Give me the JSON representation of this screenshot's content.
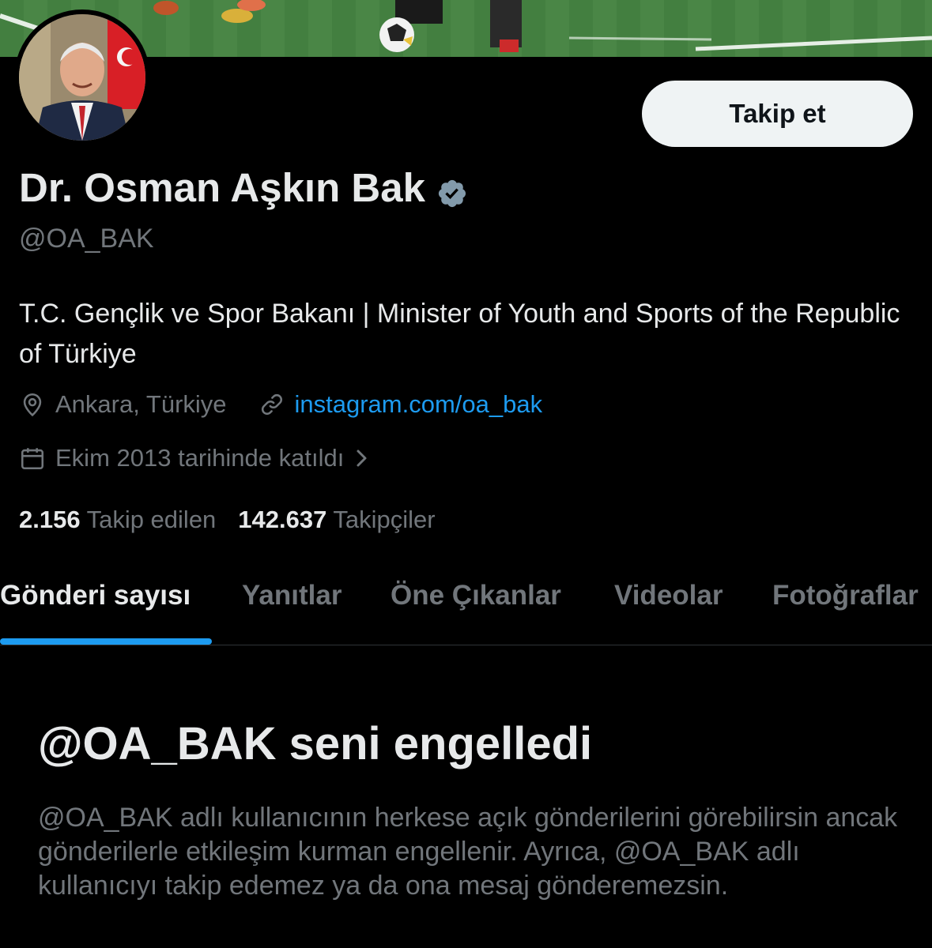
{
  "profile": {
    "display_name": "Dr. Osman Aşkın Bak",
    "handle": "@OA_BAK",
    "bio": "T.C. Gençlik ve Spor Bakanı | Minister of Youth and Sports of the Republic of Türkiye",
    "location": "Ankara, Türkiye",
    "website": "instagram.com/oa_bak",
    "joined": "Ekim 2013 tarihinde katıldı",
    "verified": true
  },
  "actions": {
    "follow_label": "Takip et"
  },
  "stats": {
    "following_count": "2.156",
    "following_label": "Takip edilen",
    "followers_count": "142.637",
    "followers_label": "Takipçiler"
  },
  "tabs": [
    {
      "label": "Gönderi sayısı",
      "active": true
    },
    {
      "label": "Yanıtlar",
      "active": false
    },
    {
      "label": "Öne Çıkanlar",
      "active": false
    },
    {
      "label": "Videolar",
      "active": false
    },
    {
      "label": "Fotoğraflar",
      "active": false
    }
  ],
  "blocked_notice": {
    "title": "@OA_BAK seni engelledi",
    "message": "@OA_BAK adlı kullanıcının herkese açık gönderilerini görebilirsin ancak gönderilerle etkileşim kurman engellenir. Ayrıca, @OA_BAK adlı kullanıcıyı takip edemez ya da ona mesaj gönderemezsin."
  },
  "icons": {
    "verified": "verified-badge-icon",
    "location": "location-pin-icon",
    "link": "link-icon",
    "calendar": "calendar-icon",
    "chevron": "chevron-right-icon"
  },
  "colors": {
    "background": "#000000",
    "primary_text": "#e7e9ea",
    "secondary_text": "#71767b",
    "accent": "#1d9bf0",
    "follow_button_bg": "#eff3f4",
    "verified_badge": "#829aab"
  }
}
